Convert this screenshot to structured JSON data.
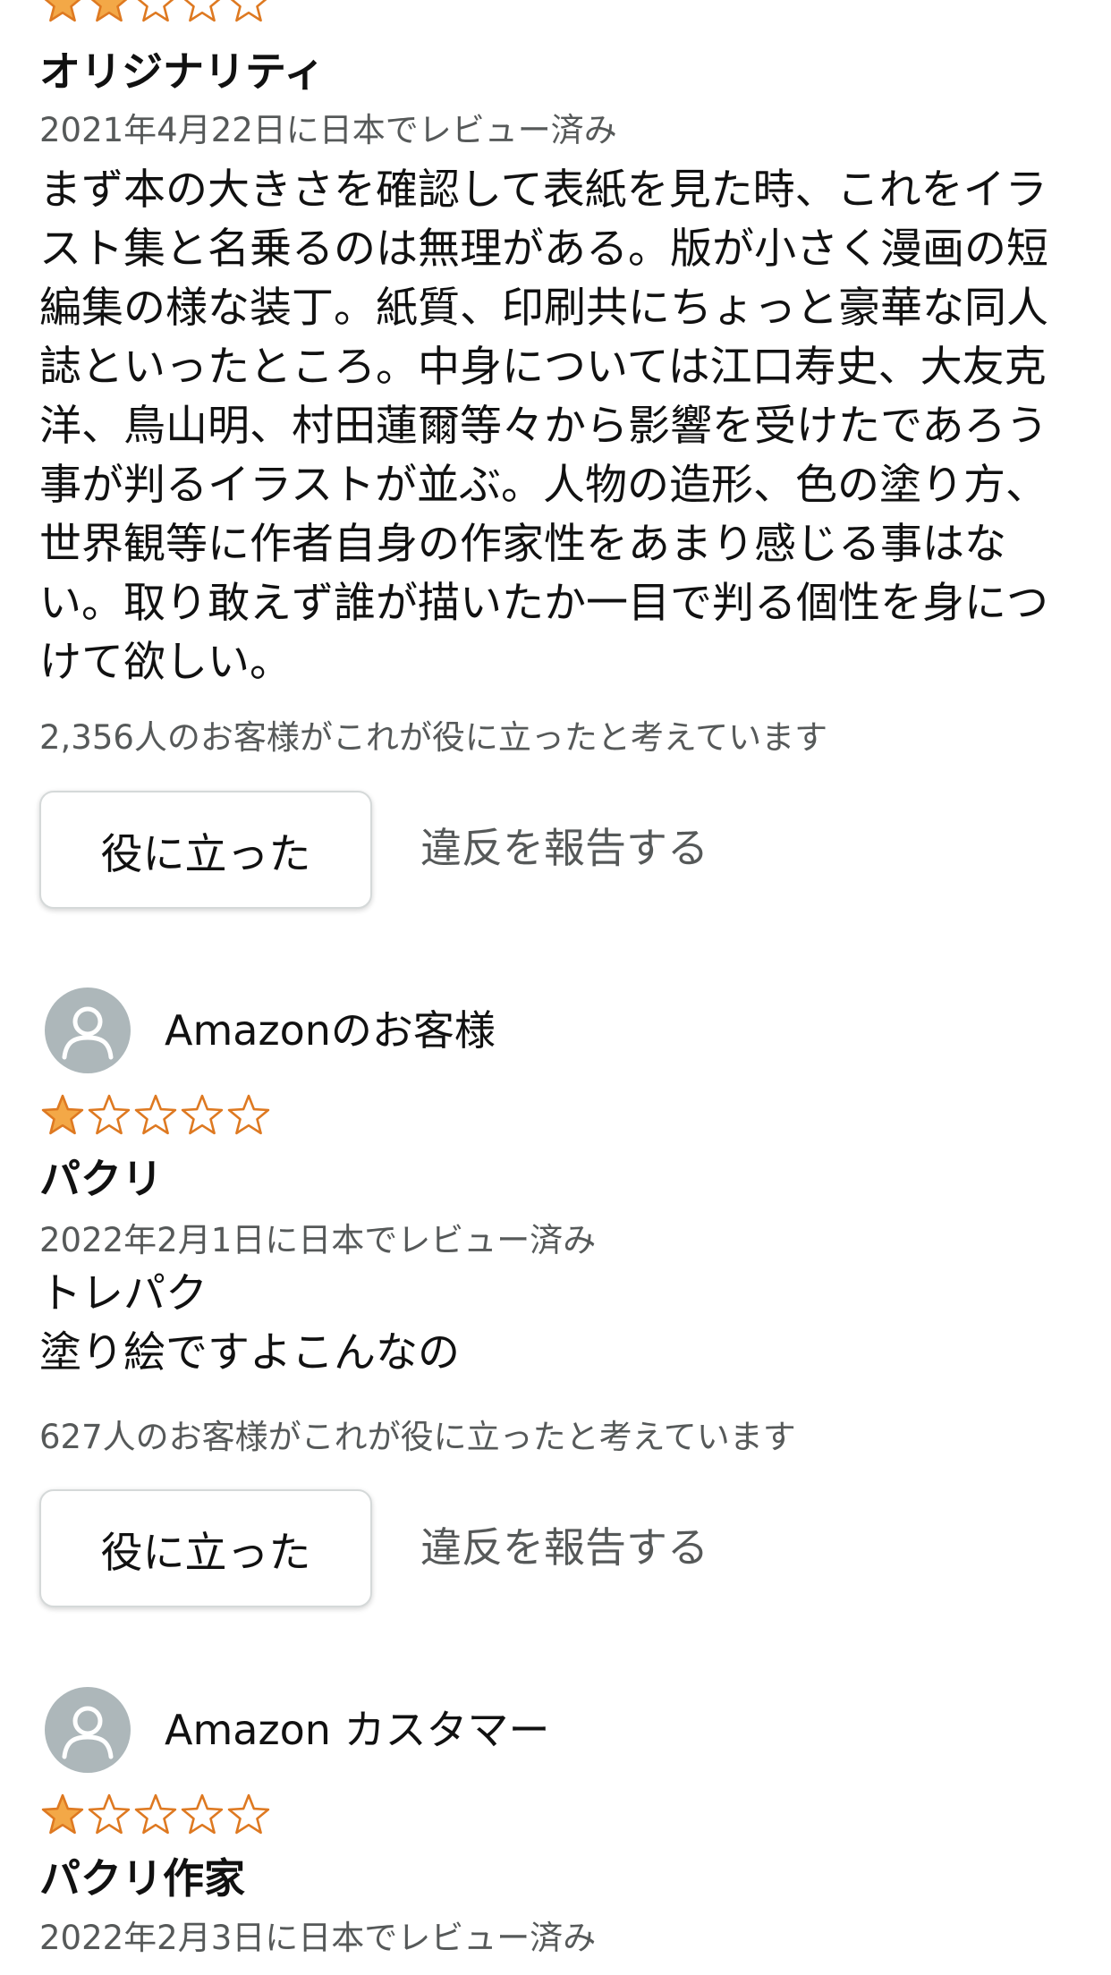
{
  "colors": {
    "star_fill": "#f3a847",
    "star_stroke": "#de7921",
    "muted_text": "#565959",
    "avatar_bg": "#adb7ba"
  },
  "reviews": [
    {
      "rating": 2,
      "title": "オリジナリティ",
      "date": "2021年4月22日に日本でレビュー済み",
      "body_lines": [
        "まず本の大きさを確認して表紙を見た時、これをイラ",
        "スト集と名乗るのは無理がある。版が小さく漫画の短",
        "編集の様な装丁。紙質、印刷共にちょっと豪華な同人",
        "誌といったところ。中身については江口寿史、大友克",
        "洋、鳥山明、村田蓮爾等々から影響を受けたであろう",
        "事が判るイラストが並ぶ。人物の造形、色の塗り方、",
        "世界観等に作者自身の作家性をあまり感じる事はな",
        "い。取り敢えず誰が描いたか一目で判る個性を身につ",
        "けて欲しい。"
      ],
      "helpful_count_text": "2,356人のお客様がこれが役に立ったと考えています",
      "helpful_label": "役に立った",
      "report_label": "違反を報告する"
    },
    {
      "reviewer": "Amazonのお客様",
      "rating": 1,
      "title": "パクリ",
      "date": "2022年2月1日に日本でレビュー済み",
      "body_lines": [
        "トレパク",
        "塗り絵ですよこんなの"
      ],
      "helpful_count_text": "627人のお客様がこれが役に立ったと考えています",
      "helpful_label": "役に立った",
      "report_label": "違反を報告する"
    },
    {
      "reviewer": "Amazon カスタマー",
      "rating": 1,
      "title": "パクリ作家",
      "date": "2022年2月3日に日本でレビュー済み"
    }
  ]
}
